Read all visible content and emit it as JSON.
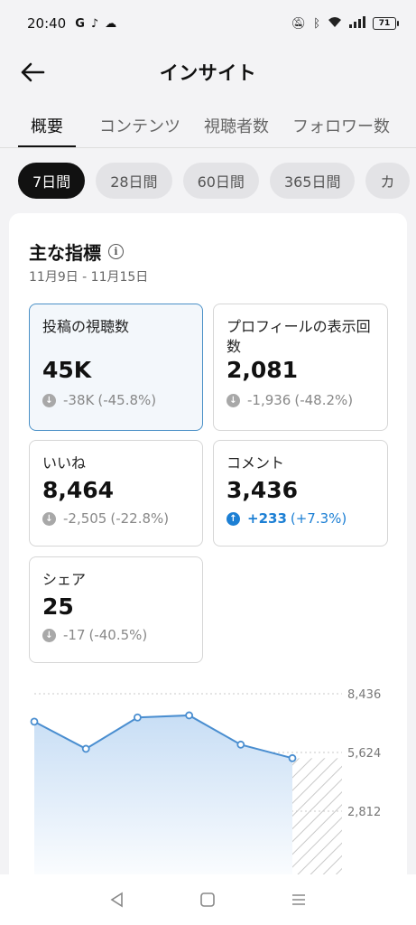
{
  "status": {
    "time": "20:40",
    "icons": [
      "G",
      "tiktok-icon",
      "cloud-icon"
    ],
    "battery": "71"
  },
  "header": {
    "title": "インサイト"
  },
  "tabs": [
    {
      "label": "概要",
      "active": true
    },
    {
      "label": "コンテンツ",
      "active": false
    },
    {
      "label": "視聴者数",
      "active": false
    },
    {
      "label": "フォロワー数",
      "active": false
    }
  ],
  "chips": [
    {
      "label": "7日間",
      "active": true
    },
    {
      "label": "28日間",
      "active": false
    },
    {
      "label": "60日間",
      "active": false
    },
    {
      "label": "365日間",
      "active": false
    },
    {
      "label": "カ",
      "active": false
    }
  ],
  "overview": {
    "title": "主な指標",
    "date_range": "11月9日 - 11月15日"
  },
  "metrics": [
    {
      "label": "投稿の視聴数",
      "value": "45K",
      "delta": "-38K",
      "pct": "(-45.8%)",
      "trend": "down",
      "selected": true
    },
    {
      "label": "プロフィールの表示回数",
      "value": "2,081",
      "delta": "-1,936",
      "pct": "(-48.2%)",
      "trend": "down",
      "selected": false
    },
    {
      "label": "いいね",
      "value": "8,464",
      "delta": "-2,505",
      "pct": "(-22.8%)",
      "trend": "down",
      "selected": false
    },
    {
      "label": "コメント",
      "value": "3,436",
      "delta": "+233",
      "pct": "(+7.3%)",
      "trend": "up",
      "selected": false
    },
    {
      "label": "シェア",
      "value": "25",
      "delta": "-17",
      "pct": "(-40.5%)",
      "trend": "down",
      "selected": false
    }
  ],
  "chart_data": {
    "type": "area",
    "y_ticks": [
      "8,436",
      "5,624",
      "2,812"
    ],
    "ylim": [
      0,
      8436
    ],
    "values": [
      7100,
      5800,
      7300,
      7400,
      6000,
      5350
    ],
    "hatched_future": true
  },
  "colors": {
    "accent": "#1c7fd4",
    "line": "#4a8ed0",
    "area": "#dbe9f8"
  }
}
